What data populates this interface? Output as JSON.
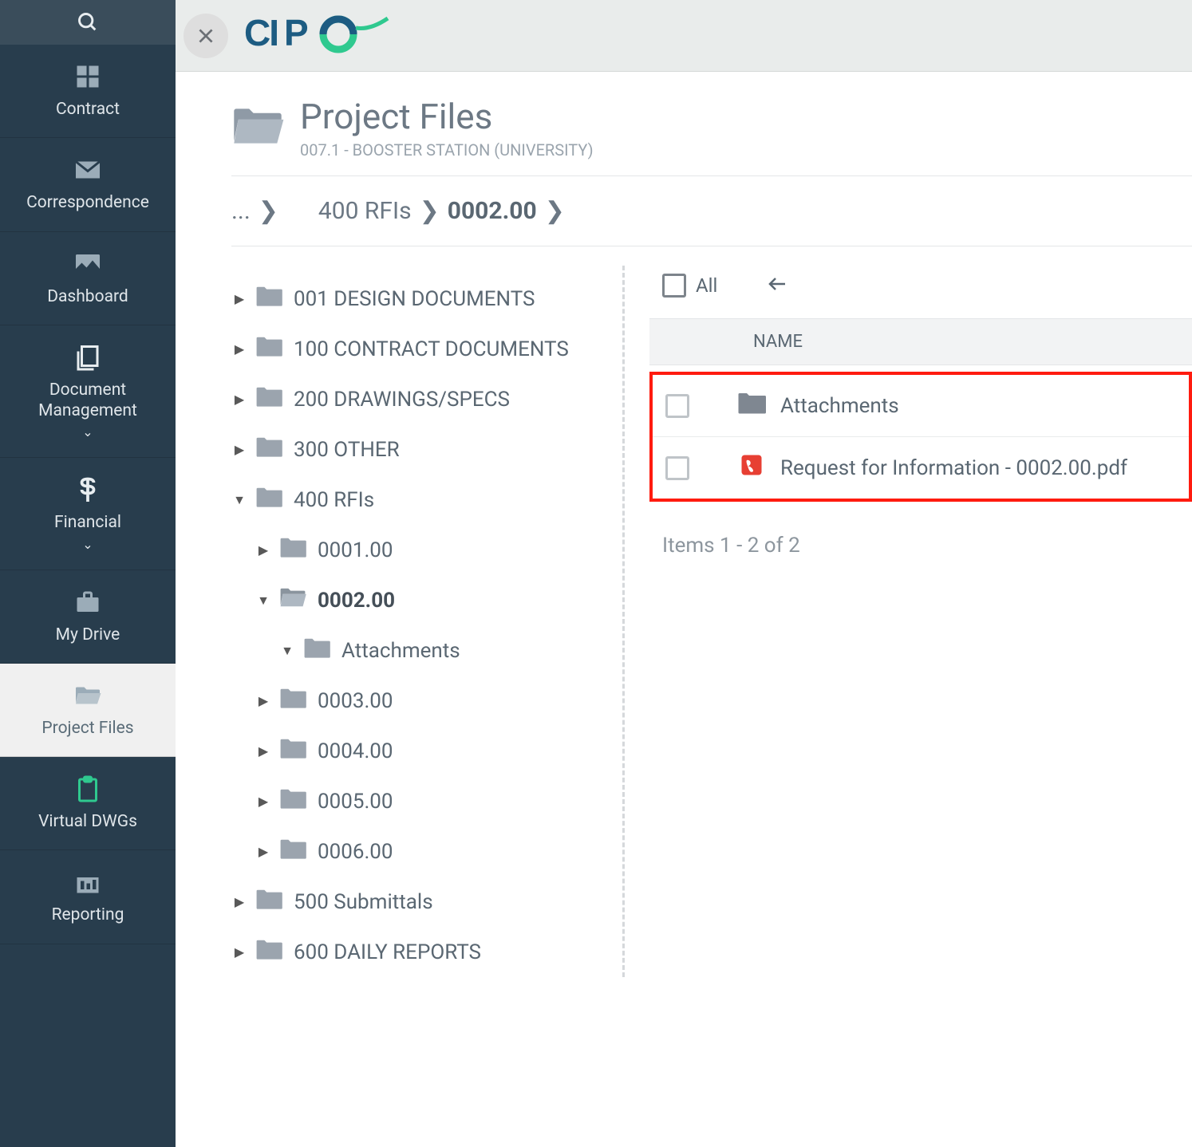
{
  "sidebar": {
    "items": [
      {
        "label": "Contract"
      },
      {
        "label": "Correspondence"
      },
      {
        "label": "Dashboard"
      },
      {
        "label": "Document Management"
      },
      {
        "label": "Financial"
      },
      {
        "label": "My Drive"
      },
      {
        "label": "Project Files"
      },
      {
        "label": "Virtual DWGs"
      },
      {
        "label": "Reporting"
      }
    ]
  },
  "header": {
    "title": "Project Files",
    "subtitle": "007.1 - BOOSTER STATION (UNIVERSITY)"
  },
  "breadcrumb": {
    "ellipsis": "...",
    "parent": "400 RFIs",
    "current": "0002.00"
  },
  "tree": [
    {
      "label": "001 DESIGN DOCUMENTS",
      "level": 0,
      "expanded": false,
      "open": false
    },
    {
      "label": "100 CONTRACT DOCUMENTS",
      "level": 0,
      "expanded": false,
      "open": false
    },
    {
      "label": "200 DRAWINGS/SPECS",
      "level": 0,
      "expanded": false,
      "open": false
    },
    {
      "label": "300 OTHER",
      "level": 0,
      "expanded": false,
      "open": false
    },
    {
      "label": "400 RFIs",
      "level": 0,
      "expanded": true,
      "open": false
    },
    {
      "label": "0001.00",
      "level": 1,
      "expanded": false,
      "open": false
    },
    {
      "label": "0002.00",
      "level": 1,
      "expanded": true,
      "open": true,
      "bold": true
    },
    {
      "label": "Attachments",
      "level": 2,
      "expanded": true,
      "open": false,
      "noarrow": false
    },
    {
      "label": "0003.00",
      "level": 1,
      "expanded": false,
      "open": false
    },
    {
      "label": "0004.00",
      "level": 1,
      "expanded": false,
      "open": false
    },
    {
      "label": "0005.00",
      "level": 1,
      "expanded": false,
      "open": false
    },
    {
      "label": "0006.00",
      "level": 1,
      "expanded": false,
      "open": false
    },
    {
      "label": "500 Submittals",
      "level": 0,
      "expanded": false,
      "open": false
    },
    {
      "label": "600 DAILY REPORTS",
      "level": 0,
      "expanded": false,
      "open": false
    }
  ],
  "list": {
    "all_label": "All",
    "name_header": "NAME",
    "rows": [
      {
        "name": "Attachments",
        "type": "folder"
      },
      {
        "name": "Request for Information - 0002.00.pdf",
        "type": "pdf"
      }
    ],
    "items_count": "Items 1 - 2 of 2"
  }
}
